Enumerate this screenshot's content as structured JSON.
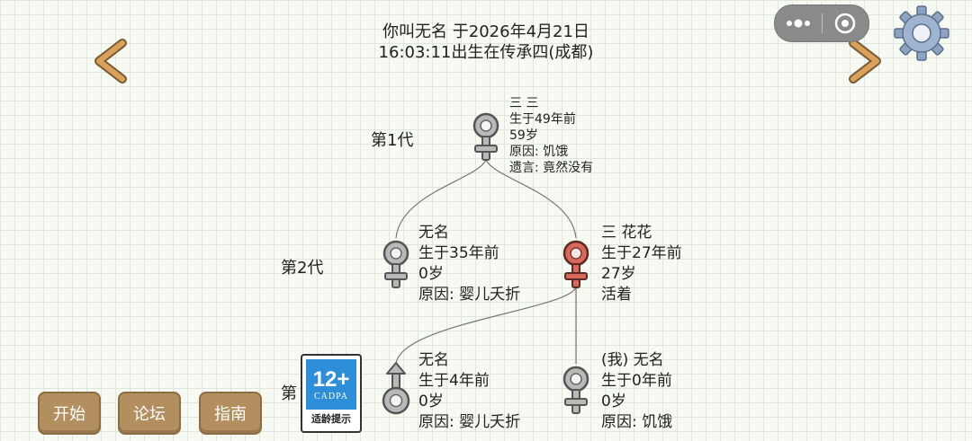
{
  "header": {
    "line1": "你叫无名 于2026年4月21日",
    "line2": "16:03:11出生在传承四(成都)"
  },
  "nav": {
    "prev_icon": "chevron-left-icon",
    "next_icon": "chevron-right-icon",
    "settings_icon": "gear-icon",
    "menu_icon": "more-dots-icon",
    "close_icon": "circle-close-icon"
  },
  "generations": [
    {
      "label": "第1代"
    },
    {
      "label": "第2代"
    },
    {
      "label": "第"
    }
  ],
  "people": {
    "g1": {
      "name": "三 三",
      "born": "生于49年前",
      "age": "59岁",
      "cause": "原因: 饥饿",
      "will": "遗言: 竟然没有",
      "gender": "female",
      "color": "#b9b9b9"
    },
    "g2a": {
      "name": "无名",
      "born": "生于35年前",
      "age": "0岁",
      "cause": "原因: 婴儿夭折",
      "gender": "female",
      "color": "#b9b9b9"
    },
    "g2b": {
      "name": "三 花花",
      "born": "生于27年前",
      "age": "27岁",
      "cause": "活着",
      "gender": "female",
      "color": "#d9675a"
    },
    "g3a": {
      "name": "无名",
      "born": "生于4年前",
      "age": "0岁",
      "cause": "原因: 婴儿夭折",
      "gender": "male",
      "color": "#b9b9b9"
    },
    "g3b": {
      "name": "(我) 无名",
      "born": "生于0年前",
      "age": "0岁",
      "cause": "原因: 饥饿",
      "gender": "female",
      "color": "#b9b9b9"
    }
  },
  "age_rating": {
    "number": "12+",
    "org": "CADPA",
    "hint": "适龄提示"
  },
  "buttons": {
    "start": "开始",
    "forum": "论坛",
    "guide": "指南"
  },
  "colors": {
    "button_bg": "#b38e5e",
    "rating_blue": "#2e8fd8",
    "alive_red": "#d9675a",
    "dead_gray": "#b9b9b9",
    "arrow_orange": "#d9a15a"
  }
}
